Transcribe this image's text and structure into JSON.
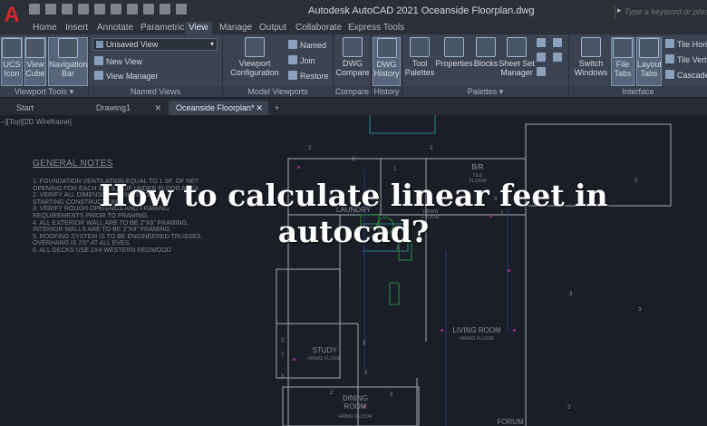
{
  "titlebar": {
    "app_logo": "A",
    "title": "Autodesk AutoCAD 2021   Oceanside Floorplan.dwg",
    "search_placeholder": "Type a keyword or phrase"
  },
  "ribbon_tabs": [
    "Home",
    "Insert",
    "Annotate",
    "Parametric",
    "View",
    "Manage",
    "Output",
    "Collaborate",
    "Express Tools"
  ],
  "active_tab": "View",
  "ribbon": {
    "viewport_tools": {
      "title": "Viewport Tools",
      "ucs_icon": "UCS\nIcon",
      "view_cube": "View\nCube",
      "navigation_bar": "Navigation\nBar"
    },
    "named_views": {
      "title": "Named Views",
      "dropdown_value": "Unsaved View",
      "new_view": "New View",
      "view_manager": "View Manager"
    },
    "model_viewports": {
      "title": "Model Viewports",
      "viewport_configuration": "Viewport\nConfiguration",
      "named": "Named",
      "join": "Join",
      "restore": "Restore"
    },
    "compare": {
      "title": "Compare",
      "dwg_compare": "DWG\nCompare"
    },
    "history": {
      "title": "History",
      "dwg_history": "DWG\nHistory"
    },
    "palettes": {
      "title": "Palettes",
      "tool_palettes": "Tool\nPalettes",
      "properties": "Properties",
      "blocks": "Blocks",
      "sheet_set_manager": "Sheet Set\nManager"
    },
    "interface": {
      "title": "Interface",
      "switch_windows": "Switch\nWindows",
      "file_tabs": "File\nTabs",
      "layout_tabs": "Layout\nTabs",
      "tile_horizontally": "Tile Hori",
      "tile_vertically": "Tile Verti",
      "cascade": "Cascade"
    }
  },
  "doc_tabs": {
    "start": "Start",
    "drawing1": "Drawing1",
    "oceanside": "Oceanside Floorplan*",
    "add": "+",
    "close": "✕"
  },
  "drawing": {
    "viewport_label": "–][Top][2D Wireframe]",
    "notes_title": "GENERAL NOTES",
    "notes": [
      "1.   FOUNDATION VENTILATION EQUAL TO 1 SF. OF NET",
      "      OPENING FOR EACH 150 S.F. OF UNDER FLOOR AREA",
      "2.   VERIFY ALL DIMENSIONS PRIOR TO",
      "      STARTING CONSTRUCTION",
      "3.   VERIFY ROUGH OPENINGS AND FRAMING",
      "      REQUIREMENTS PRIOR TO FRAMING.",
      "4.   ALL EXTERIOR WALL ARE TO BE 2\"X6\" FRAMING.",
      "      INTERIOR WALLS ARE TO BE 2\"X4\" FRAMING.",
      "5.   ROOFING SYSTEM IS TO BE ENGINEERED TRUSSES.",
      "      OVERHANG IS 2'0\" AT ALL EVES.",
      "6.   ALL DECKS USE 2X4 WESTERN REDWOOD"
    ],
    "rooms": {
      "laundry": "LAUNDRY",
      "br": "B/R",
      "br_sub": "TILE\nFLOOR",
      "hrwd": "HRWD\nFLOOR",
      "living_room": "LIVING ROOM",
      "living_sub": "HRWD FLOOR",
      "study": "STUDY",
      "study_sub": "HRWD FLOOR",
      "dining": "DINING\nROOM",
      "dining_sub": "HRWD FLOOR",
      "forum": "FORUM"
    },
    "dims": [
      "2",
      "2",
      "1",
      "2",
      "3",
      "3",
      "3",
      "2",
      "3",
      "2",
      "3",
      "3",
      "3",
      "3",
      "7",
      "3",
      "2",
      "3"
    ]
  },
  "headline": "How to calculate linear feet in autocad?",
  "colors": {
    "accent_red": "#d3262e",
    "canvas": "#222731",
    "ribbon": "#3b4350",
    "wall": "#cfd3da",
    "green": "#3fbf4f",
    "magenta": "#b93aa6",
    "cyan": "#38b6c8",
    "blue": "#3d5bd6"
  }
}
